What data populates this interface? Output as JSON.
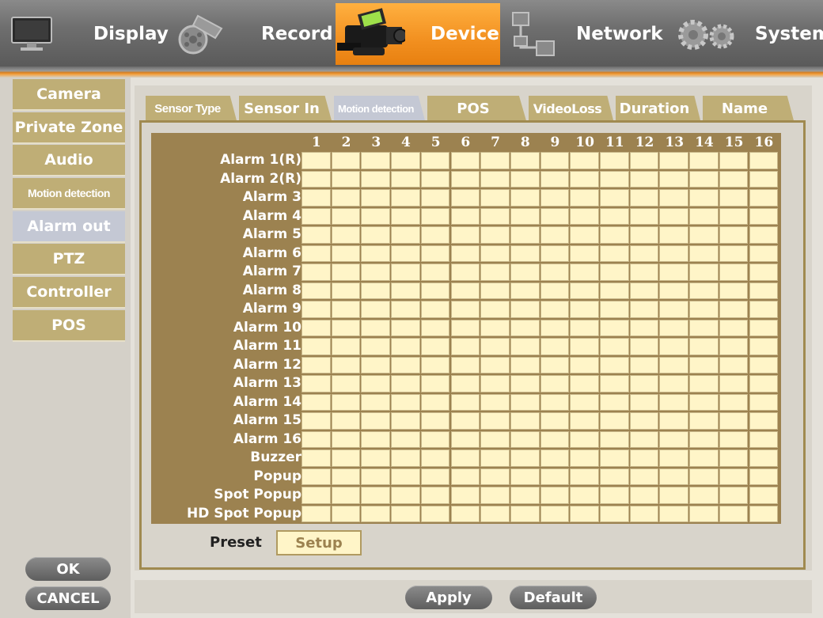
{
  "topnav": [
    {
      "label": "Display",
      "icon": "monitor-icon"
    },
    {
      "label": "Record",
      "icon": "film-reel-icon"
    },
    {
      "label": "Device",
      "icon": "camcorder-icon",
      "active": true
    },
    {
      "label": "Network",
      "icon": "network-icon"
    },
    {
      "label": "System",
      "icon": "gears-icon"
    }
  ],
  "left_menu": [
    {
      "label": "Camera"
    },
    {
      "label": "Private Zone"
    },
    {
      "label": "Audio"
    },
    {
      "label": "Motion detection"
    },
    {
      "label": "Alarm out",
      "active": true
    },
    {
      "label": "PTZ"
    },
    {
      "label": "Controller"
    },
    {
      "label": "POS"
    }
  ],
  "tabs": [
    {
      "label": "Sensor Type"
    },
    {
      "label": "Sensor In"
    },
    {
      "label": "Motion detection",
      "active": true
    },
    {
      "label": "POS"
    },
    {
      "label": "VideoLoss"
    },
    {
      "label": "Duration"
    },
    {
      "label": "Name"
    }
  ],
  "columns": [
    "1",
    "2",
    "3",
    "4",
    "5",
    "6",
    "7",
    "8",
    "9",
    "10",
    "11",
    "12",
    "13",
    "14",
    "15",
    "16"
  ],
  "rows": [
    "Alarm 1(R)",
    "Alarm 2(R)",
    "Alarm 3",
    "Alarm 4",
    "Alarm 5",
    "Alarm 6",
    "Alarm 7",
    "Alarm 8",
    "Alarm 9",
    "Alarm 10",
    "Alarm 11",
    "Alarm 12",
    "Alarm 13",
    "Alarm 14",
    "Alarm 15",
    "Alarm 16",
    "Buzzer",
    "Popup",
    "Spot Popup",
    "HD Spot Popup"
  ],
  "preset": {
    "label": "Preset",
    "button": "Setup"
  },
  "buttons": {
    "ok": "OK",
    "cancel": "CANCEL",
    "apply": "Apply",
    "default": "Default"
  },
  "colors": {
    "accent": "#f29020",
    "menu": "#bfae76",
    "grid": "#9c8250",
    "cell": "#fff5c8",
    "selected": "#c4c8d4"
  }
}
